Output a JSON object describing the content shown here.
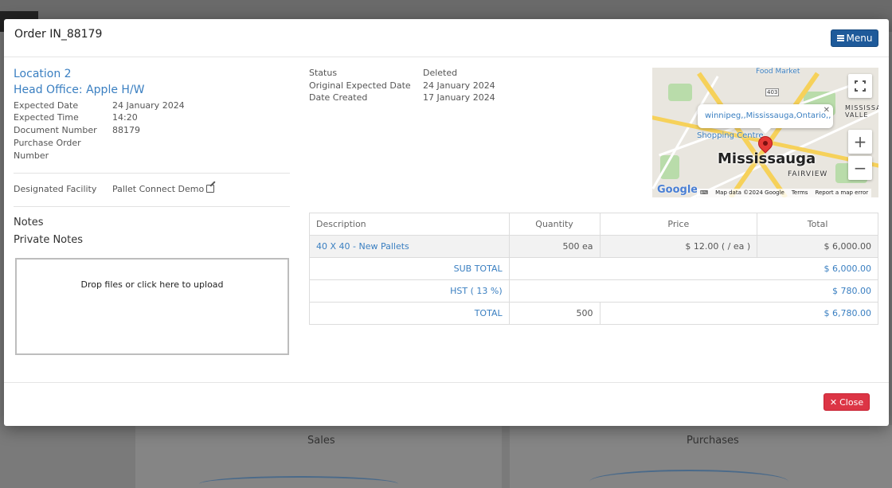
{
  "background": {
    "panel_sales": "Sales",
    "panel_purchases": "Purchases"
  },
  "modal": {
    "title": "Order IN_88179",
    "menu_label": "Menu",
    "close_label": "Close"
  },
  "location": {
    "name": "Location 2",
    "head_office": "Head Office: Apple H/W"
  },
  "details": [
    {
      "label": "Expected Date",
      "value": "24 January 2024"
    },
    {
      "label": "Expected Time",
      "value": "14:20"
    },
    {
      "label": "Document Number",
      "value": "88179"
    },
    {
      "label": "Purchase Order Number",
      "value": ""
    }
  ],
  "facility": {
    "label": "Designated Facility",
    "value": "Pallet Connect Demo"
  },
  "notes": {
    "notes_label": "Notes",
    "private_notes_label": "Private Notes",
    "dropzone_text": "Drop files or click here to upload"
  },
  "status": [
    {
      "label": "Status",
      "value": "Deleted"
    },
    {
      "label": "Original Expected Date",
      "value": "24 January 2024"
    },
    {
      "label": "Date Created",
      "value": "17 January 2024"
    }
  ],
  "map": {
    "popup_text": "winnipeg,,Mississauga,Ontario,,",
    "city_label": "Mississauga",
    "labels": {
      "food_market": "Food Market",
      "shopping_centre": "Shopping Centre",
      "fairview": "FAIRVIEW",
      "mississauga_valley": "MISSISSA VALLE",
      "route": "403"
    },
    "google": "Google",
    "attribution": {
      "data": "Map data ©2024 Google",
      "terms": "Terms",
      "report": "Report a map error"
    },
    "zoom_in": "+",
    "zoom_out": "−"
  },
  "table": {
    "headers": {
      "description": "Description",
      "quantity": "Quantity",
      "price": "Price",
      "total": "Total"
    },
    "item": {
      "description": "40 X 40 - New Pallets",
      "quantity": "500 ea",
      "price": "$ 12.00 ( / ea )",
      "total": "$ 6,000.00"
    },
    "subtotal": {
      "label": "SUB TOTAL",
      "total": "$ 6,000.00"
    },
    "tax": {
      "label": "HST ( 13 %)",
      "total": "$ 780.00"
    },
    "grand_total": {
      "label": "TOTAL",
      "quantity": "500",
      "total": "$ 6,780.00"
    }
  },
  "colors": {
    "accent": "#3a7fc1",
    "menu_button": "#1e5a9a",
    "close_button": "#dc3545"
  }
}
